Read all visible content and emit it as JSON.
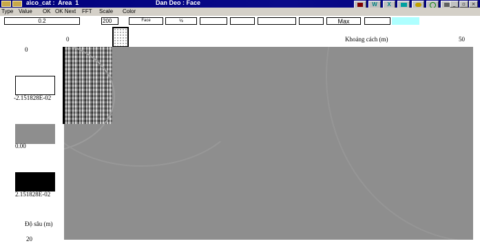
{
  "window": {
    "title_left": "a\\co_cat :  Area  1",
    "title_center": "Dan Deo : Face",
    "app_icons": [
      "app-icon-1",
      "app-icon-2"
    ],
    "tool_icons": [
      "m-tool-icon",
      "w-tool-icon",
      "x-tool-icon",
      "i-tool-icon",
      "key-tool-icon",
      "zoom-tool-icon",
      "hand-tool-icon"
    ],
    "tool_glyphs": [
      "",
      "W",
      "X",
      "",
      "",
      "",
      ""
    ],
    "window_buttons": [
      "_",
      "▫",
      "×"
    ]
  },
  "menu": [
    "Type",
    "Value",
    "OK",
    "OK Next",
    "FFT",
    "Scale",
    "Color"
  ],
  "toolbar": {
    "value_field": "0.2",
    "fft_field": "200",
    "face_button": "Face",
    "half_button": "½",
    "max_label": "Max"
  },
  "plot": {
    "x_start": "0",
    "x_axis_label": "Khoảng cách (m)",
    "x_end": "50",
    "y_axis_label": "Độ sâu (m)",
    "y_end": "20"
  },
  "scale": {
    "top_value": "0",
    "white_value": "-2.151828E-02",
    "grey_value": "0.00",
    "black_value": "2.151828E-02"
  },
  "colors": {
    "title_bar": "#00007c",
    "plot_background": "#8e8e8e",
    "swatch_white": "#ffffff",
    "swatch_grey": "#8e8e8e",
    "swatch_black": "#000000",
    "highlight_field": "#aeffff"
  }
}
